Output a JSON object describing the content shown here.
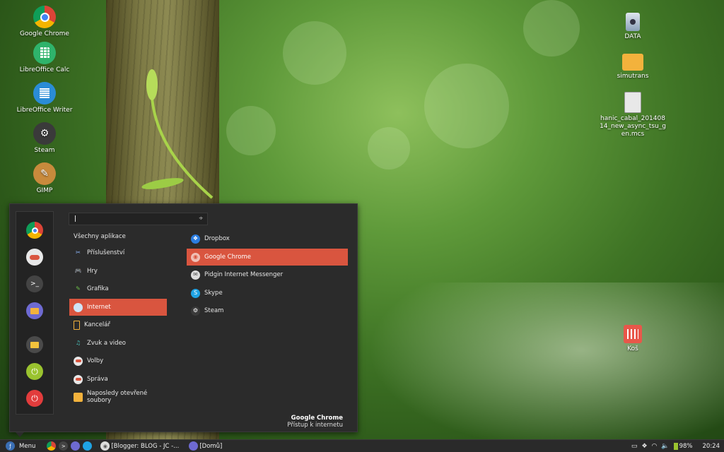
{
  "desktop": {
    "left_icons": [
      {
        "label": "Google Chrome",
        "icon": "chrome-icon"
      },
      {
        "label": "LibreOffice Calc",
        "icon": "calc-icon"
      },
      {
        "label": "LibreOffice Writer",
        "icon": "writer-icon"
      },
      {
        "label": "Steam",
        "icon": "steam-icon"
      },
      {
        "label": "GIMP",
        "icon": "gimp-icon"
      }
    ],
    "right_icons": [
      {
        "label": "DATA",
        "icon": "drive-icon"
      },
      {
        "label": "simutrans",
        "icon": "folder-icon"
      },
      {
        "label": "hanic_cabal_20140814_new_async_tsu_gen.mcs",
        "icon": "file-icon"
      },
      {
        "label": "Koš",
        "icon": "trash-icon"
      }
    ]
  },
  "menu": {
    "search": {
      "value": "",
      "placeholder": ""
    },
    "categories": [
      {
        "label": "Všechny aplikace",
        "icon": ""
      },
      {
        "label": "Příslušenství",
        "icon": "accessories-icon"
      },
      {
        "label": "Hry",
        "icon": "games-icon"
      },
      {
        "label": "Grafika",
        "icon": "graphics-icon"
      },
      {
        "label": "Internet",
        "icon": "internet-icon"
      },
      {
        "label": "Kancelář",
        "icon": "office-icon"
      },
      {
        "label": "Zvuk a video",
        "icon": "music-icon"
      },
      {
        "label": "Volby",
        "icon": "preferences-icon"
      },
      {
        "label": "Správa",
        "icon": "administration-icon"
      },
      {
        "label": "Naposledy otevřené soubory",
        "icon": "recent-files-icon"
      }
    ],
    "active_category": "Internet",
    "apps": [
      {
        "label": "Dropbox",
        "icon": "dropbox-icon"
      },
      {
        "label": "Google Chrome",
        "icon": "chrome-icon"
      },
      {
        "label": "Pidgin Internet Messenger",
        "icon": "pidgin-icon"
      },
      {
        "label": "Skype",
        "icon": "skype-icon"
      },
      {
        "label": "Steam",
        "icon": "steam-icon"
      }
    ],
    "active_app": "Google Chrome",
    "description": {
      "title": "Google Chrome",
      "subtitle": "Přístup k internetu"
    },
    "favorites": [
      "chrome-icon",
      "toggle-icon",
      "terminal-icon",
      "folder-icon",
      "monitor-icon",
      "logout-icon",
      "power-icon"
    ]
  },
  "taskbar": {
    "menu_label": "Menu",
    "tasks": [
      {
        "label": "[Blogger: BLOG - JC -...",
        "icon": "chrome-icon"
      },
      {
        "label": "[Domů]",
        "icon": "folder-icon"
      }
    ],
    "battery": "98%",
    "clock": "20:24"
  },
  "colors": {
    "accent": "#d9553f",
    "menu_bg": "#2b2b2b",
    "taskbar_bg": "#2a2a2a"
  }
}
